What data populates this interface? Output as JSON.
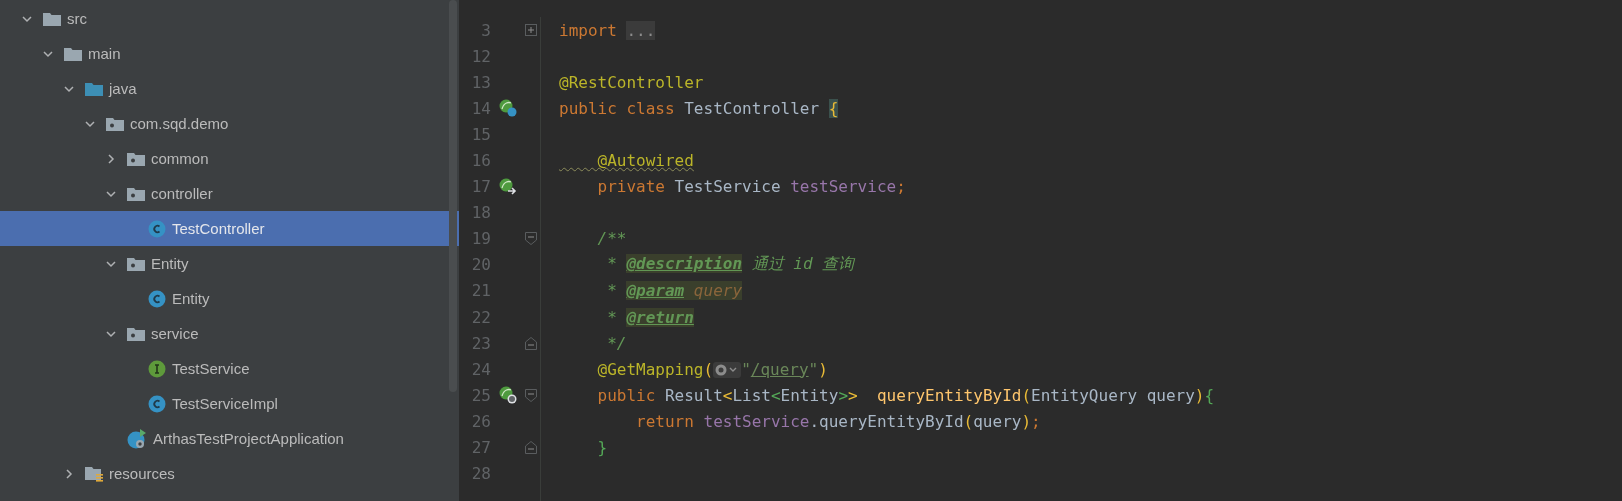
{
  "project_tree": {
    "items": [
      {
        "label": "src",
        "kind": "folder",
        "expanded": true,
        "selected": false,
        "children": [
          {
            "label": "main",
            "kind": "folder",
            "expanded": true,
            "selected": false,
            "children": [
              {
                "label": "java",
                "kind": "source-folder",
                "expanded": true,
                "selected": false,
                "children": [
                  {
                    "label": "com.sqd.demo",
                    "kind": "package",
                    "expanded": true,
                    "selected": false,
                    "children": [
                      {
                        "label": "common",
                        "kind": "package",
                        "expanded": false,
                        "selected": false
                      },
                      {
                        "label": "controller",
                        "kind": "package",
                        "expanded": true,
                        "selected": false,
                        "children": [
                          {
                            "label": "TestController",
                            "kind": "class",
                            "selected": true
                          }
                        ]
                      },
                      {
                        "label": "Entity",
                        "kind": "package",
                        "expanded": true,
                        "selected": false,
                        "children": [
                          {
                            "label": "Entity",
                            "kind": "class",
                            "selected": false
                          }
                        ]
                      },
                      {
                        "label": "service",
                        "kind": "package",
                        "expanded": true,
                        "selected": false,
                        "children": [
                          {
                            "label": "TestService",
                            "kind": "interface",
                            "selected": false
                          },
                          {
                            "label": "TestServiceImpl",
                            "kind": "class",
                            "selected": false
                          }
                        ]
                      },
                      {
                        "label": "ArthasTestProjectApplication",
                        "kind": "application",
                        "selected": false
                      }
                    ]
                  }
                ]
              },
              {
                "label": "resources",
                "kind": "resources-folder",
                "expanded": false,
                "selected": false
              }
            ]
          }
        ]
      }
    ]
  },
  "editor": {
    "lines": [
      {
        "number": "3",
        "fold": {
          "kind": "collapsed"
        },
        "tokens": [
          {
            "kind": "keyword",
            "text": "import "
          },
          {
            "kind": "folded",
            "text": "..."
          }
        ]
      },
      {
        "number": "12"
      },
      {
        "number": "13",
        "tokens": [
          {
            "kind": "annotation",
            "text": "@RestController"
          }
        ]
      },
      {
        "number": "14",
        "gutter": {
          "kind": "bean-class"
        },
        "tokens": [
          {
            "kind": "keyword",
            "text": "public class "
          },
          {
            "kind": "plain",
            "text": "TestController "
          },
          {
            "kind": "brace-match",
            "text": "{"
          }
        ]
      },
      {
        "number": "15"
      },
      {
        "number": "16",
        "tokens": [
          {
            "kind": "annotation-warning",
            "text": "    @Autowired"
          }
        ]
      },
      {
        "number": "17",
        "gutter": {
          "kind": "bean-injected"
        },
        "tokens": [
          {
            "kind": "keyword",
            "text": "    private "
          },
          {
            "kind": "plain",
            "text": "TestService "
          },
          {
            "kind": "field",
            "text": "testService"
          },
          {
            "kind": "keyword",
            "text": ";"
          }
        ]
      },
      {
        "number": "18"
      },
      {
        "number": "19",
        "fold": {
          "kind": "start"
        },
        "tokens": [
          {
            "kind": "doc",
            "text": "    /**"
          }
        ]
      },
      {
        "number": "20",
        "tokens": [
          {
            "kind": "doc",
            "text": "     * "
          },
          {
            "kind": "doc-tag",
            "text": "@description"
          },
          {
            "kind": "doc",
            "text": " 通过 id 查询"
          }
        ]
      },
      {
        "number": "21",
        "tokens": [
          {
            "kind": "doc",
            "text": "     * "
          },
          {
            "kind": "doc-tag",
            "text": "@param"
          },
          {
            "kind": "doc-param",
            "text": " query"
          }
        ]
      },
      {
        "number": "22",
        "tokens": [
          {
            "kind": "doc",
            "text": "     * "
          },
          {
            "kind": "doc-tag",
            "text": "@return"
          }
        ]
      },
      {
        "number": "23",
        "fold": {
          "kind": "end"
        },
        "tokens": [
          {
            "kind": "doc",
            "text": "     */"
          }
        ]
      },
      {
        "number": "24",
        "tokens": [
          {
            "kind": "annotation",
            "text": "    @GetMapping"
          },
          {
            "kind": "bracket-outer",
            "text": "("
          },
          {
            "kind": "inlay"
          },
          {
            "kind": "string",
            "text": "\""
          },
          {
            "kind": "string-link",
            "text": "/query"
          },
          {
            "kind": "string",
            "text": "\""
          },
          {
            "kind": "bracket-outer",
            "text": ")"
          }
        ]
      },
      {
        "number": "25",
        "gutter": {
          "kind": "bean-web"
        },
        "fold": {
          "kind": "start"
        },
        "tokens": [
          {
            "kind": "keyword",
            "text": "    public "
          },
          {
            "kind": "plain",
            "text": "Result"
          },
          {
            "kind": "bracket-outer",
            "text": "<"
          },
          {
            "kind": "plain",
            "text": "List"
          },
          {
            "kind": "bracket-inner",
            "text": "<"
          },
          {
            "kind": "plain",
            "text": "Entity"
          },
          {
            "kind": "bracket-inner",
            "text": ">"
          },
          {
            "kind": "bracket-outer",
            "text": ">  "
          },
          {
            "kind": "method",
            "text": "queryEntityById"
          },
          {
            "kind": "bracket-outer",
            "text": "("
          },
          {
            "kind": "plain",
            "text": "EntityQuery query"
          },
          {
            "kind": "bracket-outer",
            "text": ")"
          },
          {
            "kind": "bracket-inner",
            "text": "{"
          }
        ]
      },
      {
        "number": "26",
        "tokens": [
          {
            "kind": "keyword",
            "text": "        return "
          },
          {
            "kind": "field",
            "text": "testService"
          },
          {
            "kind": "plain",
            "text": ".queryEntityById"
          },
          {
            "kind": "bracket-outer",
            "text": "("
          },
          {
            "kind": "plain",
            "text": "query"
          },
          {
            "kind": "bracket-outer",
            "text": ")"
          },
          {
            "kind": "keyword",
            "text": ";"
          }
        ]
      },
      {
        "number": "27",
        "fold": {
          "kind": "end"
        },
        "tokens": [
          {
            "kind": "bracket-inner",
            "text": "    }"
          }
        ]
      },
      {
        "number": "28"
      }
    ]
  }
}
